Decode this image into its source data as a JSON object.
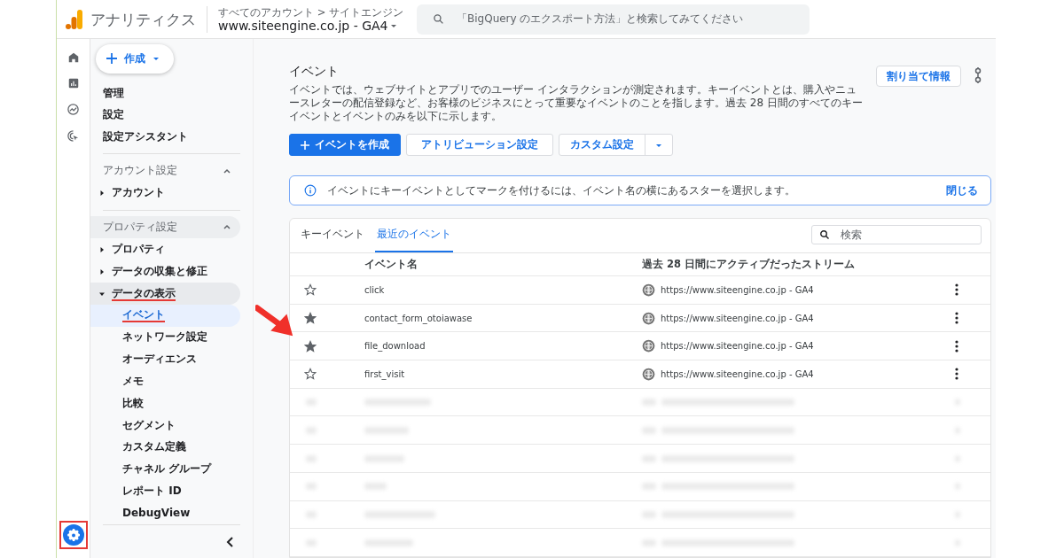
{
  "header": {
    "app_name": "アナリティクス",
    "breadcrumb": "すべてのアカウント > サイトエンジン",
    "property": "www.siteengine.co.jp - GA4",
    "search_placeholder": "「BigQuery のエクスポート方法」と検索してみてください"
  },
  "rail": {
    "settings_highlighted": true
  },
  "sidebar": {
    "create_button": "作成",
    "top_items": [
      "管理",
      "設定",
      "設定アシスタント"
    ],
    "sections": [
      {
        "title": "アカウント設定",
        "expanded": true,
        "highlighted": false,
        "items": [
          {
            "label": "アカウント",
            "expanded": false,
            "annotated": false
          }
        ]
      },
      {
        "title": "プロパティ設定",
        "expanded": true,
        "highlighted": true,
        "items": [
          {
            "label": "プロパティ",
            "expanded": false,
            "annotated": false
          },
          {
            "label": "データの収集と修正",
            "expanded": false,
            "annotated": false
          },
          {
            "label": "データの表示",
            "expanded": true,
            "annotated": true,
            "children": [
              {
                "label": "イベント",
                "selected": true,
                "annotated": true
              },
              {
                "label": "ネットワーク設定",
                "selected": false,
                "annotated": false
              },
              {
                "label": "オーディエンス",
                "selected": false,
                "annotated": false
              },
              {
                "label": "メモ",
                "selected": false,
                "annotated": false
              },
              {
                "label": "比較",
                "selected": false,
                "annotated": false
              },
              {
                "label": "セグメント",
                "selected": false,
                "annotated": false
              },
              {
                "label": "カスタム定義",
                "selected": false,
                "annotated": false
              },
              {
                "label": "チャネル グループ",
                "selected": false,
                "annotated": false
              },
              {
                "label": "レポート ID",
                "selected": false,
                "annotated": false
              },
              {
                "label": "DebugView",
                "selected": false,
                "annotated": false
              }
            ]
          }
        ]
      }
    ]
  },
  "main": {
    "title": "イベント",
    "description": "イベントでは、ウェブサイトとアプリでのユーザー インタラクションが測定されます。キーイベントとは、購入やニュースレターの配信登録など、お客様のビジネスにとって重要なイベントのことを指します。過去 28 日間のすべてのキーイベントとイベントのみを以下に示します。",
    "assign_button": "割り当て情報",
    "buttons": [
      {
        "label": "イベントを作成",
        "kind": "primary"
      },
      {
        "label": "アトリビューション設定",
        "kind": "outline"
      },
      {
        "label": "カスタム設定",
        "kind": "split"
      }
    ],
    "info": {
      "text": "イベントにキーイベントとしてマークを付けるには、イベント名の横にあるスターを選択します。",
      "close": "閉じる"
    },
    "tabs": [
      {
        "label": "キーイベント",
        "selected": false
      },
      {
        "label": "最近のイベント",
        "selected": true
      }
    ],
    "search_placeholder": "検索",
    "columns": [
      "イベント名",
      "過去 28 日間にアクティブだったストリーム"
    ],
    "rows": [
      {
        "kind": "event",
        "name": "click",
        "stream": "https://www.siteengine.co.jp - GA4",
        "starred": false,
        "arrow": false
      },
      {
        "kind": "event",
        "name": "contact_form_otoiawase",
        "stream": "https://www.siteengine.co.jp - GA4",
        "starred": true,
        "arrow": true
      },
      {
        "kind": "event",
        "name": "file_download",
        "stream": "https://www.siteengine.co.jp - GA4",
        "starred": true,
        "arrow": false
      },
      {
        "kind": "event",
        "name": "first_visit",
        "stream": "https://www.siteengine.co.jp - GA4",
        "starred": false,
        "arrow": false
      },
      {
        "kind": "blurred"
      },
      {
        "kind": "blurred"
      },
      {
        "kind": "blurred"
      },
      {
        "kind": "blurred"
      },
      {
        "kind": "blurred"
      },
      {
        "kind": "blurred"
      }
    ]
  }
}
